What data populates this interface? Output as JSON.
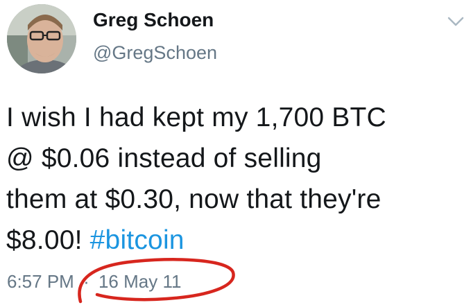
{
  "author": {
    "display_name": "Greg Schoen",
    "handle": "@GregSchoen",
    "avatar_icon": "user-photo-avatar"
  },
  "menu_icon": "chevron-down-icon",
  "tweet": {
    "lines": [
      "I wish I had kept my 1,700 BTC",
      "@ $0.06 instead of selling",
      "them at $0.30, now that they're",
      "$8.00! "
    ],
    "hashtag": "#bitcoin"
  },
  "meta": {
    "time": "6:57 PM",
    "separator": "·",
    "date": "16 May 11"
  },
  "annotation": {
    "type": "hand-drawn red circle around timestamp",
    "color": "#d7261e"
  },
  "colors": {
    "text": "#14171a",
    "secondary": "#657786",
    "link": "#1b95e0"
  }
}
